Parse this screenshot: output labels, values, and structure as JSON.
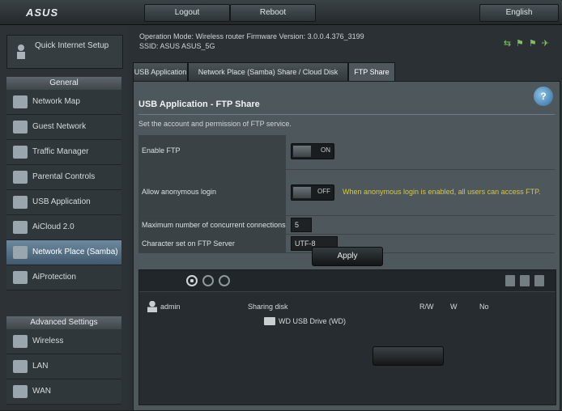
{
  "header": {
    "logo": "ASUS",
    "buttons": [
      "Logout",
      "Reboot"
    ],
    "language": "English"
  },
  "sidebar": {
    "wizard_label": "Quick Internet Setup",
    "general_heading": "General",
    "general_items": [
      {
        "label": "Network Map",
        "icon": "network-map-icon"
      },
      {
        "label": "Guest Network",
        "icon": "guest-network-icon"
      },
      {
        "label": "Traffic Manager",
        "icon": "traffic-manager-icon"
      },
      {
        "label": "Parental Controls",
        "icon": "parental-controls-icon"
      },
      {
        "label": "USB Application",
        "icon": "usb-application-icon"
      },
      {
        "label": "AiCloud 2.0",
        "icon": "aicloud-icon"
      },
      {
        "label": "Network Place (Samba)",
        "icon": "network-place-icon"
      },
      {
        "label": "AiProtection",
        "icon": "aiprotection-icon"
      }
    ],
    "advanced_heading": "Advanced Settings",
    "advanced_items": [
      {
        "label": "Wireless",
        "icon": "wireless-icon"
      },
      {
        "label": "LAN",
        "icon": "lan-icon"
      },
      {
        "label": "WAN",
        "icon": "wan-icon"
      }
    ],
    "active_item": "Network Place (Samba)"
  },
  "top": {
    "operation_mode_line1": "Operation Mode: Wireless router   Firmware Version: 3.0.0.4.376_3199",
    "operation_mode_line2": "SSID: ASUS  ASUS_5G"
  },
  "tabs": [
    {
      "label": "USB Application"
    },
    {
      "label": "Network Place (Samba) Share / Cloud Disk"
    },
    {
      "label": "FTP Share"
    }
  ],
  "active_tab": "FTP Share",
  "panel": {
    "title": "USB Application - FTP Share",
    "description": "Set the account and permission of FTP service.",
    "help_icon": "?",
    "rows": [
      {
        "label": "Enable FTP",
        "toggle": "ON",
        "note": ""
      },
      {
        "label": "Allow anonymous login",
        "toggle": "OFF",
        "note": "When anonymous login is enabled, all users can access FTP."
      },
      {
        "label": "Maximum number of concurrent connections",
        "value": "5",
        "note": ""
      },
      {
        "label": "Character set on FTP Server",
        "value": "UTF-8",
        "note": ""
      }
    ],
    "apply_label": "Apply"
  },
  "accounts": {
    "user": "admin",
    "share_column": "Sharing disk",
    "permissions": [
      "R/W",
      "W",
      "No"
    ],
    "folder": "WD USB Drive (WD)",
    "save_label": ""
  }
}
